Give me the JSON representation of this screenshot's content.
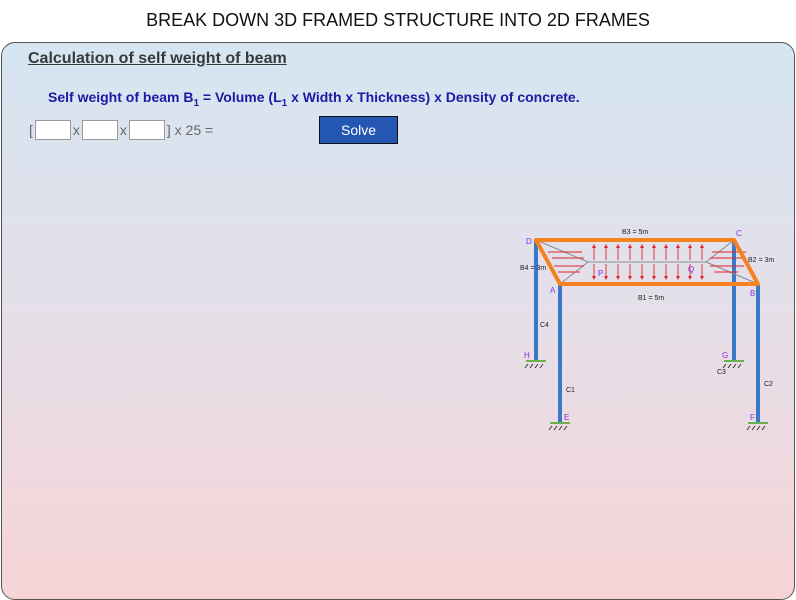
{
  "header": {
    "title": "BREAK DOWN 3D FRAMED STRUCTURE INTO 2D FRAMES"
  },
  "section": {
    "heading": "Calculation of self weight of beam",
    "formula_prefix": "Self weight of beam B",
    "formula_sub": "1",
    "formula_mid": " = Volume (L",
    "formula_sub2": "1",
    "formula_suffix": " x Width x Thickness) x Density of concrete."
  },
  "calc": {
    "open_bracket": "[",
    "times_1": "x",
    "times_2": "x",
    "close_text": "] x 25 =",
    "length_value": "",
    "width_value": "",
    "thickness_value": "",
    "solve_label": "Solve"
  },
  "diagram": {
    "beam_labels": {
      "b1": "B1 = 5m",
      "b2": "B2 = 3m",
      "b3": "B3 = 5m",
      "b4": "B4 = 3m"
    },
    "column_labels": {
      "c1": "C1",
      "c2": "C2",
      "c3": "C3",
      "c4": "C4"
    },
    "node_labels": {
      "a": "A",
      "b": "B",
      "c": "C",
      "d": "D",
      "e": "E",
      "f": "F",
      "g": "G",
      "h": "H",
      "p": "P",
      "q": "Q"
    },
    "colors": {
      "beam": "#f5821f",
      "column": "#3a78c8",
      "support": "#6ab04c",
      "load": "#e0242a",
      "node": "#8a2be2"
    }
  }
}
